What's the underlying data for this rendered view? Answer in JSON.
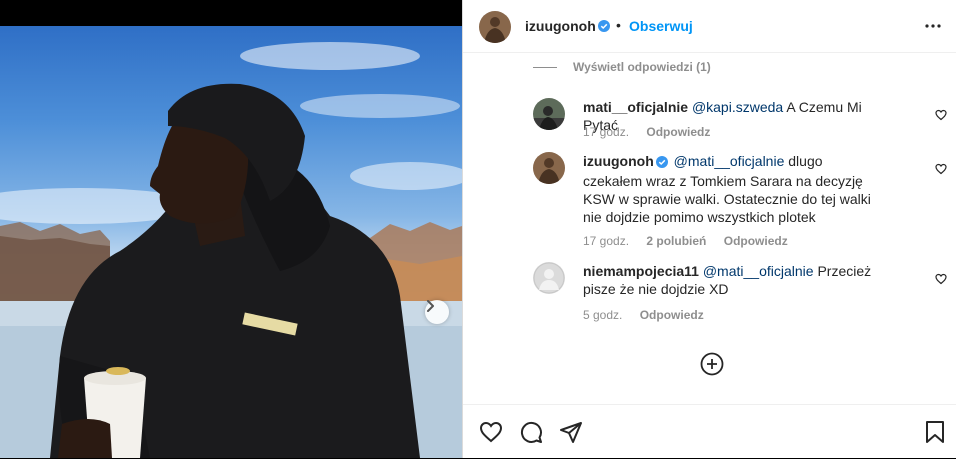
{
  "post": {
    "username": "izuugonoh",
    "follow_label": "Obserwuj",
    "separator": "•"
  },
  "thread": {
    "view_replies": "Wyświetl odpowiedzi (1)"
  },
  "comments": [
    {
      "username": "mati__oficjalnie",
      "mention": "@kapi.szweda",
      "text": " A Czemu Mi Pytać",
      "time": "17 godz.",
      "likes": "",
      "reply_label": "Odpowiedz"
    },
    {
      "username": "izuugonoh",
      "mention": "@mati__oficjalnie",
      "text": " dlugo czekałem wraz z Tomkiem Sarara na decyzję KSW w sprawie walki. Ostatecznie do tej walki nie dojdzie pomimo wszystkich plotek",
      "time": "17 godz.",
      "likes": "2 polubień",
      "reply_label": "Odpowiedz"
    },
    {
      "username": "niemampojecia11",
      "mention": "@mati__oficjalnie",
      "text": " Przecież pisze że nie dojdzie XD",
      "time": "5 godz.",
      "likes": "",
      "reply_label": "Odpowiedz"
    }
  ],
  "icons": {
    "verified": "verified-badge-icon",
    "more": "more-horizontal-icon",
    "like": "heart-icon",
    "comment": "speech-bubble-icon",
    "share": "paper-plane-icon",
    "save": "bookmark-icon",
    "add": "plus-circle-icon",
    "next": "chevron-right-icon"
  },
  "colors": {
    "accent": "#0095f6",
    "verified": "#3897f0",
    "text": "#262626",
    "secondary": "#8e8e8e",
    "mention": "#00376b"
  }
}
